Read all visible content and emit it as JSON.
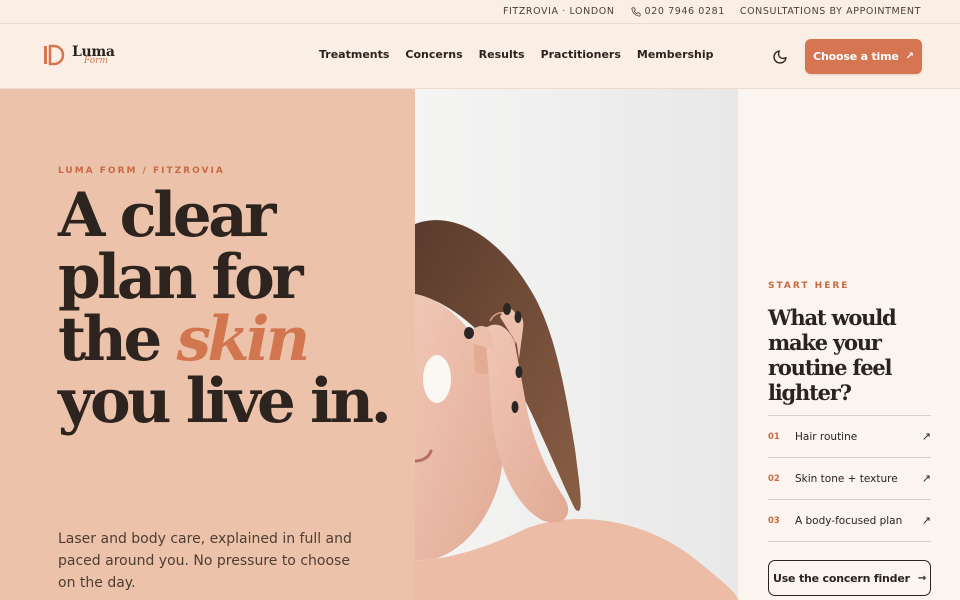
{
  "topbar": {
    "location": "FITZROVIA · LONDON",
    "phone": "020 7946 0281",
    "note": "CONSULTATIONS BY APPOINTMENT"
  },
  "brand": {
    "name": "Luma",
    "sub": "Form"
  },
  "nav": {
    "items": [
      {
        "label": "Treatments"
      },
      {
        "label": "Concerns"
      },
      {
        "label": "Results"
      },
      {
        "label": "Practitioners"
      },
      {
        "label": "Membership"
      }
    ],
    "cta_label": "Choose a time"
  },
  "hero": {
    "eyebrow": "LUMA FORM / FITZROVIA",
    "headline_1": "A clear plan for the",
    "headline_accent": "skin",
    "headline_2": "you live in.",
    "lede": "Laser and body care, explained in full and paced around you. No pressure to choose on the day."
  },
  "panel": {
    "eyebrow": "START HERE",
    "title": "What would make your routine feel lighter?",
    "options": [
      {
        "num": "01",
        "label": "Hair routine"
      },
      {
        "num": "02",
        "label": "Skin tone + texture"
      },
      {
        "num": "03",
        "label": "A body-focused plan"
      }
    ],
    "finder_label": "Use the concern finder"
  },
  "icons": {
    "phone": "phone-icon",
    "theme": "moon-icon",
    "arrow_up_right": "arrow-up-right-icon",
    "arrow_right": "arrow-right-icon"
  },
  "colors": {
    "accent": "#d67552",
    "hero_bg": "#ecc3aa",
    "page_bg": "#fcf3ec",
    "ink": "#2b231e"
  }
}
